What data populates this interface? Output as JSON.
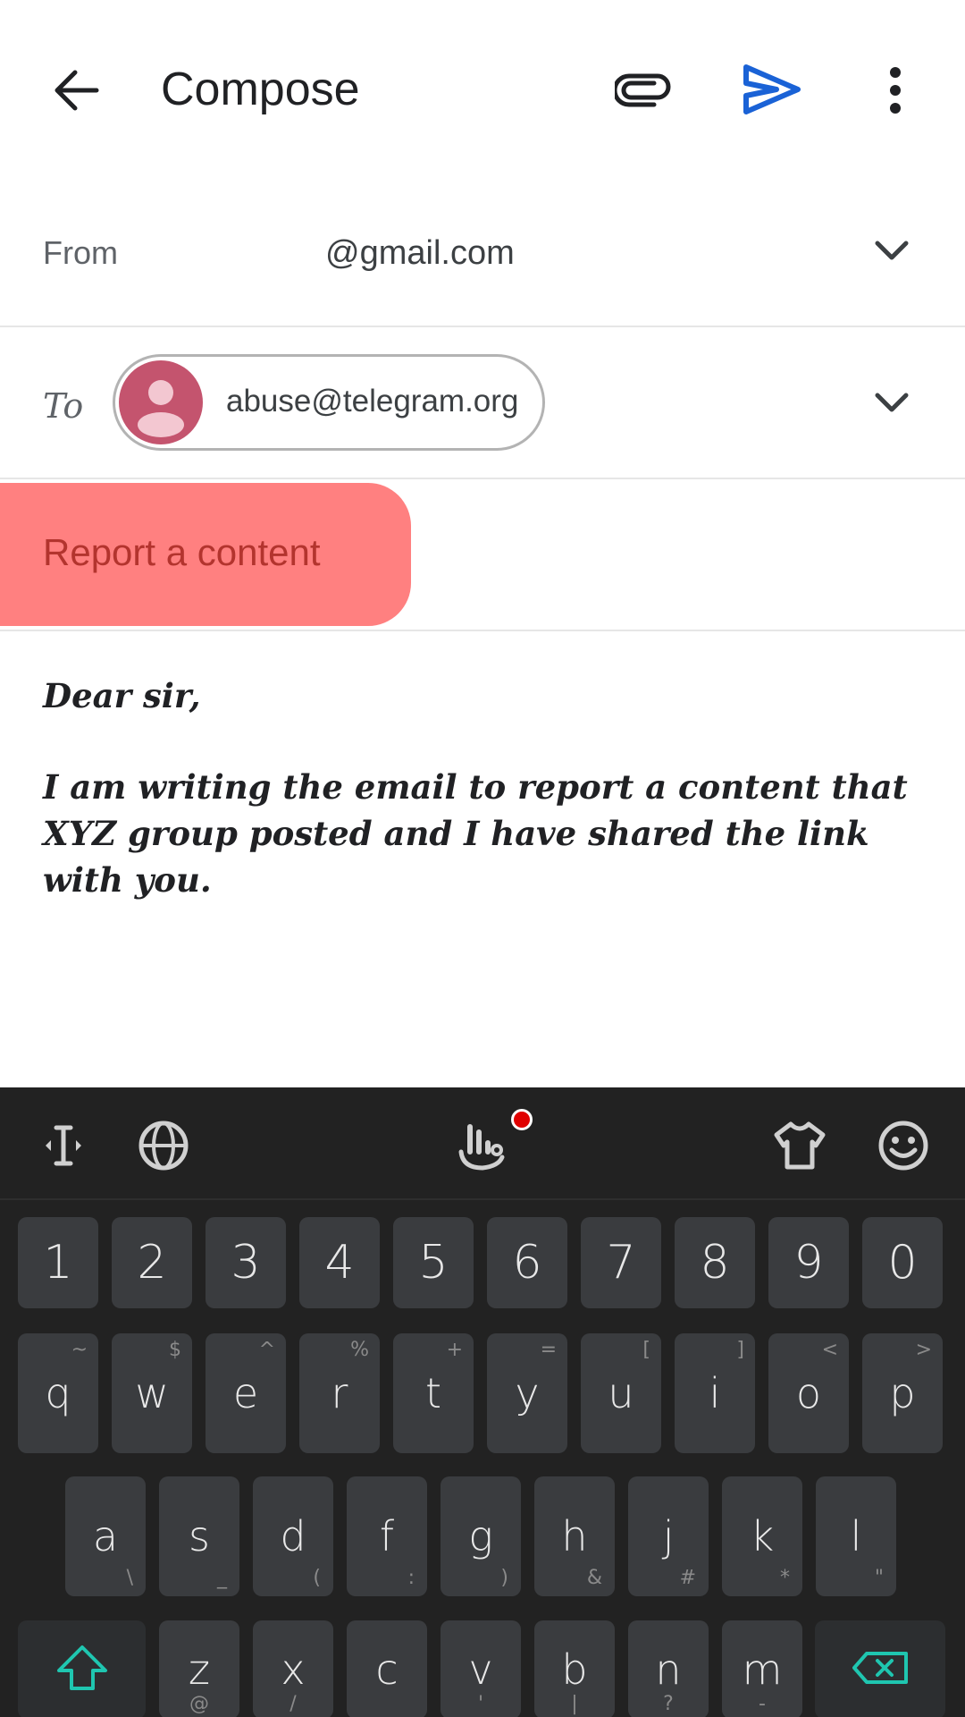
{
  "header": {
    "title": "Compose",
    "icons": {
      "back": "arrow-left-icon",
      "attach": "paperclip-icon",
      "send": "send-icon",
      "more": "more-vertical-icon"
    },
    "send_color": "#1a62d6"
  },
  "from": {
    "label": "From",
    "value": "@gmail.com"
  },
  "to": {
    "label": "To",
    "recipient": "abuse@telegram.org",
    "avatar_color": "#c4546e"
  },
  "subject": {
    "value": "Report a content",
    "highlight_color": "#ff8080"
  },
  "body": {
    "greeting": "Dear sir,",
    "paragraph": "I am writing the email to report a content that XYZ group posted and I have shared the link with you."
  },
  "keyboard": {
    "toolbar": {
      "cursor_icon": "text-cursor-icon",
      "globe_icon": "globe-icon",
      "gesture_icon": "hand-gesture-icon",
      "theme_icon": "shirt-icon",
      "emoji_icon": "emoji-icon"
    },
    "numbers": [
      "1",
      "2",
      "3",
      "4",
      "5",
      "6",
      "7",
      "8",
      "9",
      "0"
    ],
    "row1": [
      {
        "k": "q",
        "alt": "~"
      },
      {
        "k": "w",
        "alt": "$"
      },
      {
        "k": "e",
        "alt": "^"
      },
      {
        "k": "r",
        "alt": "%"
      },
      {
        "k": "t",
        "alt": "+"
      },
      {
        "k": "y",
        "alt": "="
      },
      {
        "k": "u",
        "alt": "["
      },
      {
        "k": "i",
        "alt": "]"
      },
      {
        "k": "o",
        "alt": "<"
      },
      {
        "k": "p",
        "alt": ">"
      }
    ],
    "row2": [
      {
        "k": "a",
        "alt": "\\"
      },
      {
        "k": "s",
        "alt": "_"
      },
      {
        "k": "d",
        "alt": "("
      },
      {
        "k": "f",
        "alt": ":"
      },
      {
        "k": "g",
        "alt": ")"
      },
      {
        "k": "h",
        "alt": "&"
      },
      {
        "k": "j",
        "alt": "#"
      },
      {
        "k": "k",
        "alt": "*"
      },
      {
        "k": "l",
        "alt": "\""
      }
    ],
    "row3": [
      {
        "k": "z",
        "alt": "@"
      },
      {
        "k": "x",
        "alt": "/"
      },
      {
        "k": "c",
        "alt": ""
      },
      {
        "k": "v",
        "alt": "'"
      },
      {
        "k": "b",
        "alt": "|"
      },
      {
        "k": "n",
        "alt": "?"
      },
      {
        "k": "m",
        "alt": "-"
      }
    ],
    "shift_icon": "shift-icon",
    "backspace_icon": "backspace-icon"
  }
}
